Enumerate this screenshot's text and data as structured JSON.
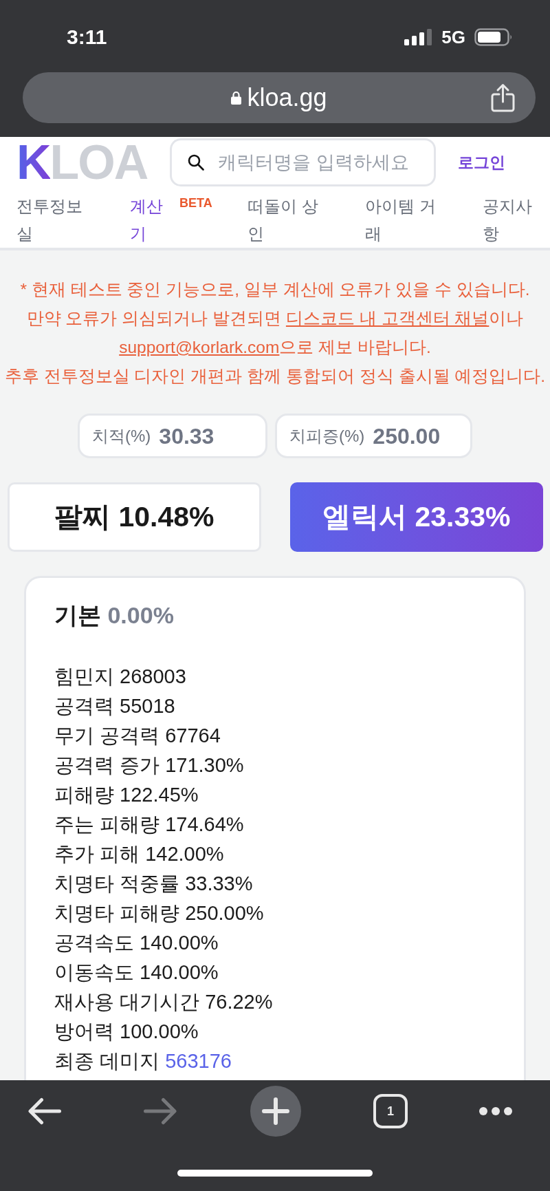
{
  "status_bar": {
    "time": "3:11",
    "network": "5G"
  },
  "browser": {
    "url": "kloa.gg",
    "tab_count": "1",
    "back": {
      "disabled": false
    },
    "forward": {
      "disabled": true
    }
  },
  "header": {
    "logo": {
      "accent": "K",
      "rest": "LOA"
    },
    "search": {
      "placeholder": "캐릭터명을 입력하세요"
    },
    "login": "로그인"
  },
  "nav": {
    "tabs": [
      {
        "label": "전투정보실",
        "selected": false
      },
      {
        "label": "계산기",
        "selected": true,
        "badge": "BETA"
      },
      {
        "label": "떠돌이 상인",
        "selected": false
      },
      {
        "label": "아이템 거래",
        "selected": false
      },
      {
        "label": "공지사항",
        "selected": false
      }
    ]
  },
  "notice": {
    "lines": [
      [
        {
          "kind": "text",
          "text": "* 현재 테스트 중인 기능으로, 일부 계산에 오류가 있을 수 있습니다."
        }
      ],
      [
        {
          "kind": "text",
          "text": "만약 오류가 의심되거나 발견되면 "
        },
        {
          "kind": "link",
          "text": "디스코드 내 고객센터 채널"
        },
        {
          "kind": "text",
          "text": "이나"
        }
      ],
      [
        {
          "kind": "link",
          "text": "support@korlark.com"
        },
        {
          "kind": "text",
          "text": "으로 제보 바랍니다."
        }
      ],
      [
        {
          "kind": "text",
          "text": "추후 전투정보실 디자인 개편과 함께 통합되어 정식 출시될 예정입니다."
        }
      ]
    ]
  },
  "inputs": [
    {
      "label": "치적(%)",
      "value": "30.33"
    },
    {
      "label": "치피증(%)",
      "value": "250.00"
    }
  ],
  "modes": [
    {
      "label": "팔찌 10.48%",
      "selected": false
    },
    {
      "label": "엘릭서 23.33%",
      "selected": true
    }
  ],
  "result": {
    "title": "기본",
    "percent": "0.00%",
    "stats": [
      {
        "kind": "plain",
        "label": "힘민지",
        "value": "268003"
      },
      {
        "kind": "plain",
        "label": "공격력",
        "value": "55018"
      },
      {
        "kind": "plain",
        "label": "무기 공격력",
        "value": "67764"
      },
      {
        "kind": "plain",
        "label": "공격력 증가",
        "value": "171.30%"
      },
      {
        "kind": "plain",
        "label": "피해량",
        "value": "122.45%"
      },
      {
        "kind": "plain",
        "label": "주는 피해량",
        "value": "174.64%"
      },
      {
        "kind": "plain",
        "label": "추가 피해",
        "value": "142.00%"
      },
      {
        "kind": "plain",
        "label": "치명타 적중률",
        "value": "33.33%"
      },
      {
        "kind": "plain",
        "label": "치명타 피해량",
        "value": "250.00%"
      },
      {
        "kind": "plain",
        "label": "공격속도",
        "value": "140.00%"
      },
      {
        "kind": "plain",
        "label": "이동속도",
        "value": "140.00%"
      },
      {
        "kind": "plain",
        "label": "재사용 대기시간",
        "value": "76.22%"
      },
      {
        "kind": "plain",
        "label": "방어력",
        "value": "100.00%"
      },
      {
        "kind": "total",
        "label": "최종 데미지",
        "value": "563176"
      }
    ]
  }
}
